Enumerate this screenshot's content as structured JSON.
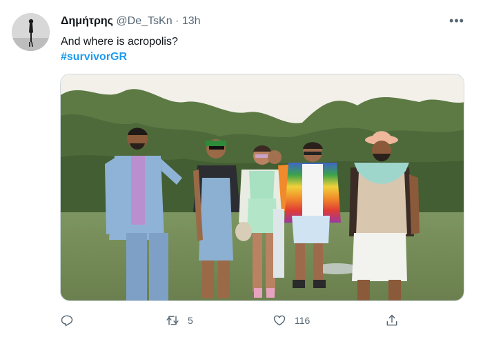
{
  "tweet": {
    "author_name": "Δημήτρης",
    "handle": "@De_TsKn",
    "separator": "·",
    "time": "13h",
    "more_label": "•••",
    "text": "And where is acropolis?",
    "hashtag": "#survivorGR",
    "media_icon": "photo"
  },
  "actions": {
    "reply": {
      "icon": "reply-icon"
    },
    "retweet": {
      "icon": "retweet-icon",
      "count": "5"
    },
    "like": {
      "icon": "heart-icon",
      "count": "116"
    },
    "share": {
      "icon": "share-icon"
    }
  },
  "colors": {
    "hashtag": "#1d9bf0",
    "secondary_text": "#536471",
    "primary_text": "#0f1419",
    "background": "#ffffff"
  }
}
